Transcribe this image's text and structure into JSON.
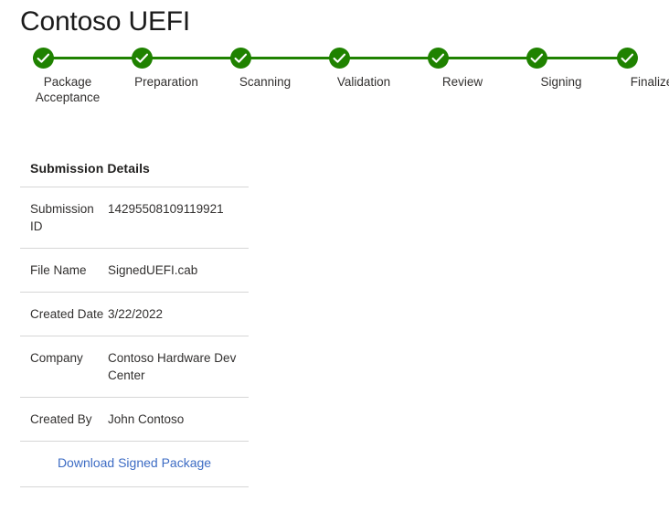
{
  "page": {
    "title": "Contoso UEFI"
  },
  "stepper": {
    "accent_color": "#1f8200",
    "steps": [
      {
        "label": "Package Acceptance",
        "state": "completed",
        "icon": "check-icon"
      },
      {
        "label": "Preparation",
        "state": "completed",
        "icon": "check-icon"
      },
      {
        "label": "Scanning",
        "state": "completed",
        "icon": "check-icon"
      },
      {
        "label": "Validation",
        "state": "completed",
        "icon": "check-icon"
      },
      {
        "label": "Review",
        "state": "completed",
        "icon": "check-icon"
      },
      {
        "label": "Signing",
        "state": "completed",
        "icon": "check-icon"
      },
      {
        "label": "Finalize",
        "state": "completed",
        "icon": "check-icon"
      }
    ]
  },
  "details": {
    "title": "Submission Details",
    "rows": [
      {
        "key": "Submission ID",
        "value": "14295508109119921"
      },
      {
        "key": "File Name",
        "value": "SignedUEFI.cab"
      },
      {
        "key": "Created Date",
        "value": "3/22/2022"
      },
      {
        "key": "Company",
        "value": "Contoso Hardware Dev Center"
      },
      {
        "key": "Created By",
        "value": "John Contoso"
      }
    ],
    "action": {
      "label": "Download Signed Package",
      "color": "#3d6cc4"
    }
  }
}
